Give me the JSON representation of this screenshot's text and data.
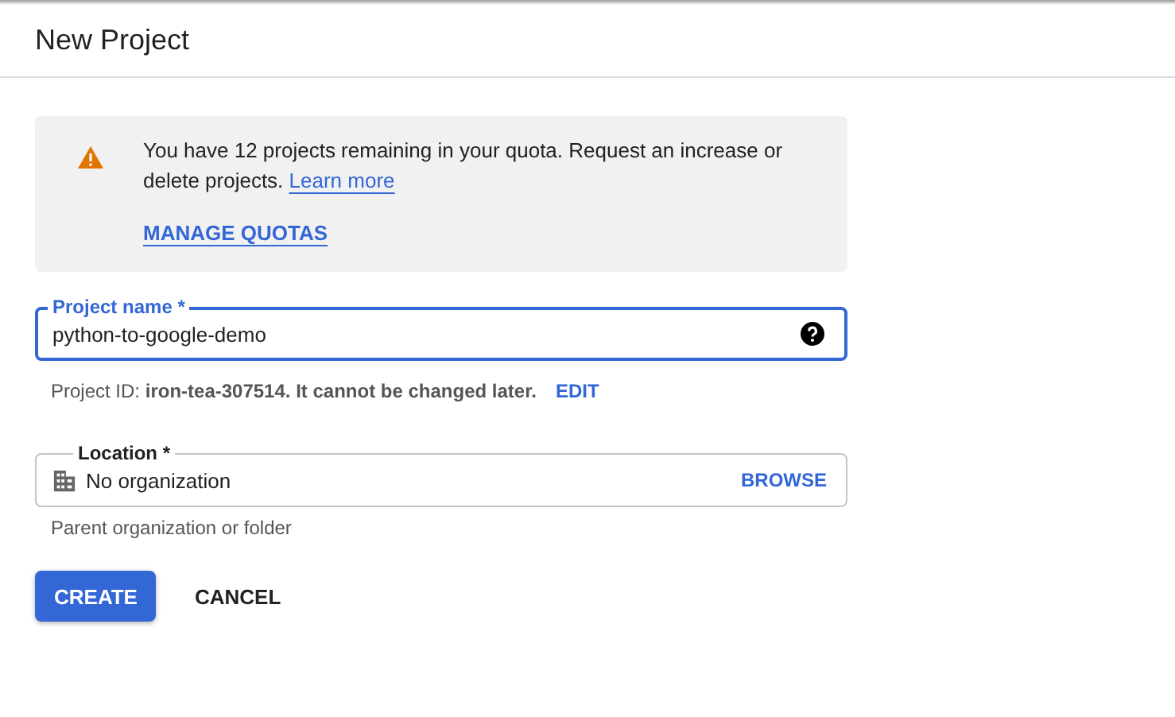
{
  "page_title": "New Project",
  "quota_notice": {
    "message": "You have 12 projects remaining in your quota. Request an increase or delete projects.",
    "link": "Learn more",
    "action": "MANAGE QUOTAS"
  },
  "project_name": {
    "label": "Project name *",
    "value": "python-to-google-demo",
    "focused": true
  },
  "project_id": {
    "text": "Project ID: **iron-tea-307514. It cannot be changed later.**",
    "action": "EDIT"
  },
  "location": {
    "label": "Location *",
    "value": "No organization",
    "action": "BROWSE",
    "hint": "Parent organization or folder",
    "focused": false
  },
  "buttons": [
    {
      "label": "CREATE",
      "kind": "primary"
    },
    {
      "label": "CANCEL",
      "kind": "text"
    }
  ]
}
